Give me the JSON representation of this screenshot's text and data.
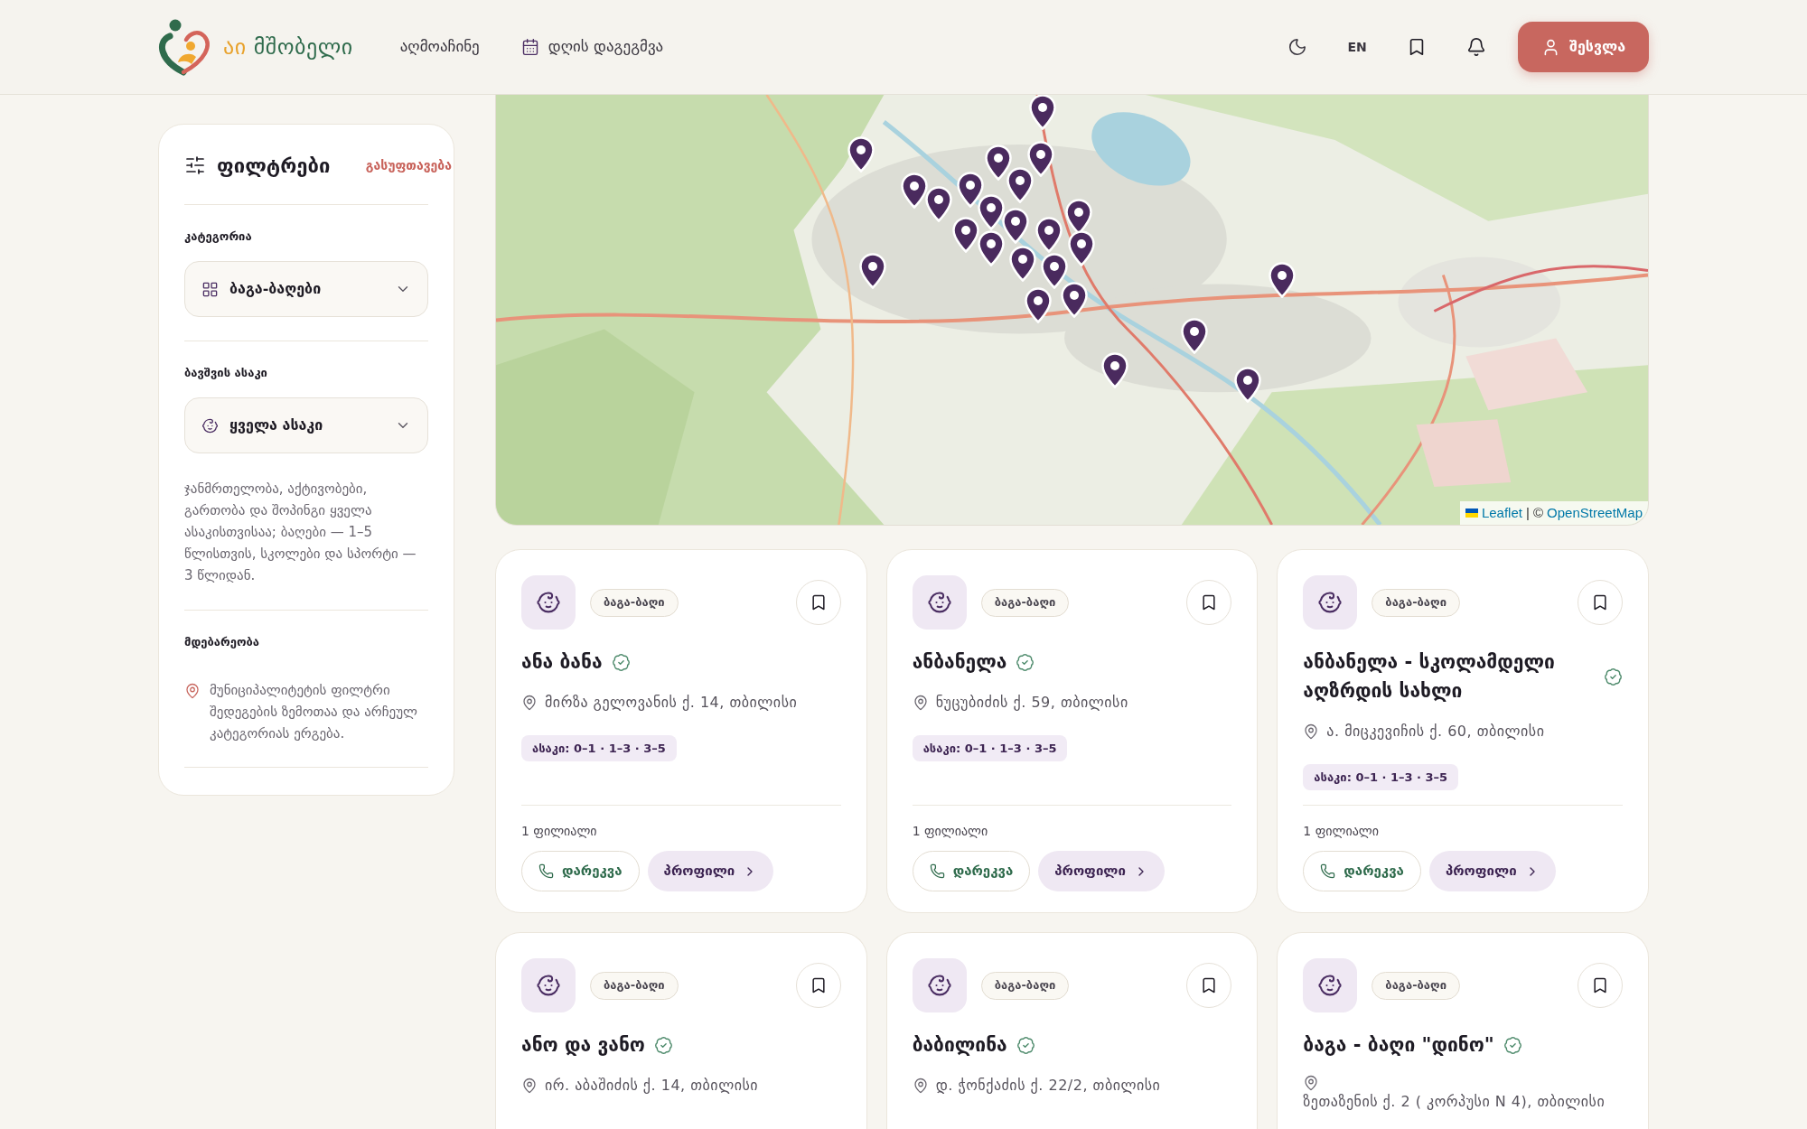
{
  "header": {
    "logo": {
      "part_1": "აი",
      "part_2": "მშობელი"
    },
    "nav": [
      {
        "kind": "plain",
        "label": "აღმოაჩინე"
      },
      {
        "kind": "calendar",
        "label": "დღის დაგეგმვა"
      }
    ],
    "language": "EN",
    "login": "შესვლა"
  },
  "filters": {
    "title": "ფილტრები",
    "clear": "გასუფთავება",
    "sections": [
      {
        "kind": "category",
        "label": "კატეგორია",
        "value": "ბაგა-ბაღები"
      },
      {
        "kind": "age",
        "label": "ბავშვის ასაკი",
        "value": "ყველა ასაკი",
        "note": "ჯანმრთელობა, აქტივობები, გართობა და შოპინგი ყველა ასაკისთვისაა; ბაღები — 1–5 წლისთვის, სკოლები და სპორტი — 3 წლიდან."
      },
      {
        "kind": "location",
        "label": "მდებარეობა",
        "note": "მუნიციპალიტეტის ფილტრი შედეგების ზემოთაა და არჩეულ კატეგორიას ერგება."
      }
    ]
  },
  "map": {
    "attribution": {
      "leaflet": "Leaflet",
      "separator": "| ©",
      "osm": "OpenStreetMap"
    }
  },
  "cards": [
    {
      "category": "ბაგა-ბაღი",
      "saved": false,
      "name": "ანა ბანა",
      "verified": true,
      "address": "მირზა გელოვანის ქ. 14, თბილისი",
      "ages": "ასაკი: 0–1 · 1–3 · 3–5",
      "branches": "1 ფილიალი",
      "call": "დარეკვა",
      "profile": "პროფილი"
    },
    {
      "category": "ბაგა-ბაღი",
      "saved": false,
      "name": "ანბანელა",
      "verified": true,
      "address": "ნუცუბიძის ქ. 59, თბილისი",
      "ages": "ასაკი: 0–1 · 1–3 · 3–5",
      "branches": "1 ფილიალი",
      "call": "დარეკვა",
      "profile": "პროფილი"
    },
    {
      "category": "ბაგა-ბაღი",
      "saved": false,
      "name": "ანბანელა - სკოლამდელი აღზრდის სახლი",
      "verified": true,
      "address": "ა. მიცკევიჩის ქ. 60, თბილისი",
      "ages": "ასაკი: 0–1 · 1–3 · 3–5",
      "branches": "1 ფილიალი",
      "call": "დარეკვა",
      "profile": "პროფილი"
    },
    {
      "category": "ბაგა-ბაღი",
      "saved": false,
      "name": "ანო და ვანო",
      "verified": true,
      "address": "ირ. აბაშიძის ქ. 14, თბილისი"
    },
    {
      "category": "ბაგა-ბაღი",
      "saved": false,
      "name": "ბაბილინა",
      "verified": true,
      "address": "დ. ჭონქაძის ქ. 22/2, თბილისი"
    },
    {
      "category": "ბაგა-ბაღი",
      "saved": false,
      "name": "ბაგა - ბაღი \"დინო\"",
      "verified": true,
      "address": "ზეთაზენის ქ. 2 ( კორპუსი N 4), თბილისი"
    }
  ]
}
